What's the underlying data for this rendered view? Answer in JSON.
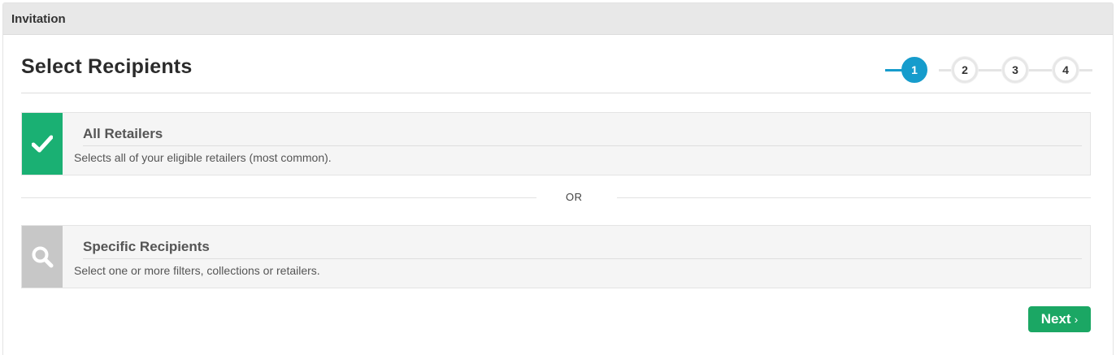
{
  "panel": {
    "title": "Invitation"
  },
  "page": {
    "title": "Select Recipients"
  },
  "stepper": {
    "current": 1,
    "steps": [
      "1",
      "2",
      "3",
      "4"
    ],
    "active_color": "#169ccc"
  },
  "options": [
    {
      "title": "All Retailers",
      "description": "Selects all of your eligible retailers (most common).",
      "icon": "checkmark-icon",
      "selected": true,
      "icon_color": "#1ab073"
    },
    {
      "title": "Specific Recipients",
      "description": "Select one or more filters, collections or retailers.",
      "icon": "search-icon",
      "selected": false,
      "icon_color": "#c7c7c7"
    }
  ],
  "divider": {
    "label": "OR"
  },
  "actions": {
    "next_label": "Next",
    "next_icon": "chevron-right-icon",
    "next_color": "#1ba764"
  }
}
